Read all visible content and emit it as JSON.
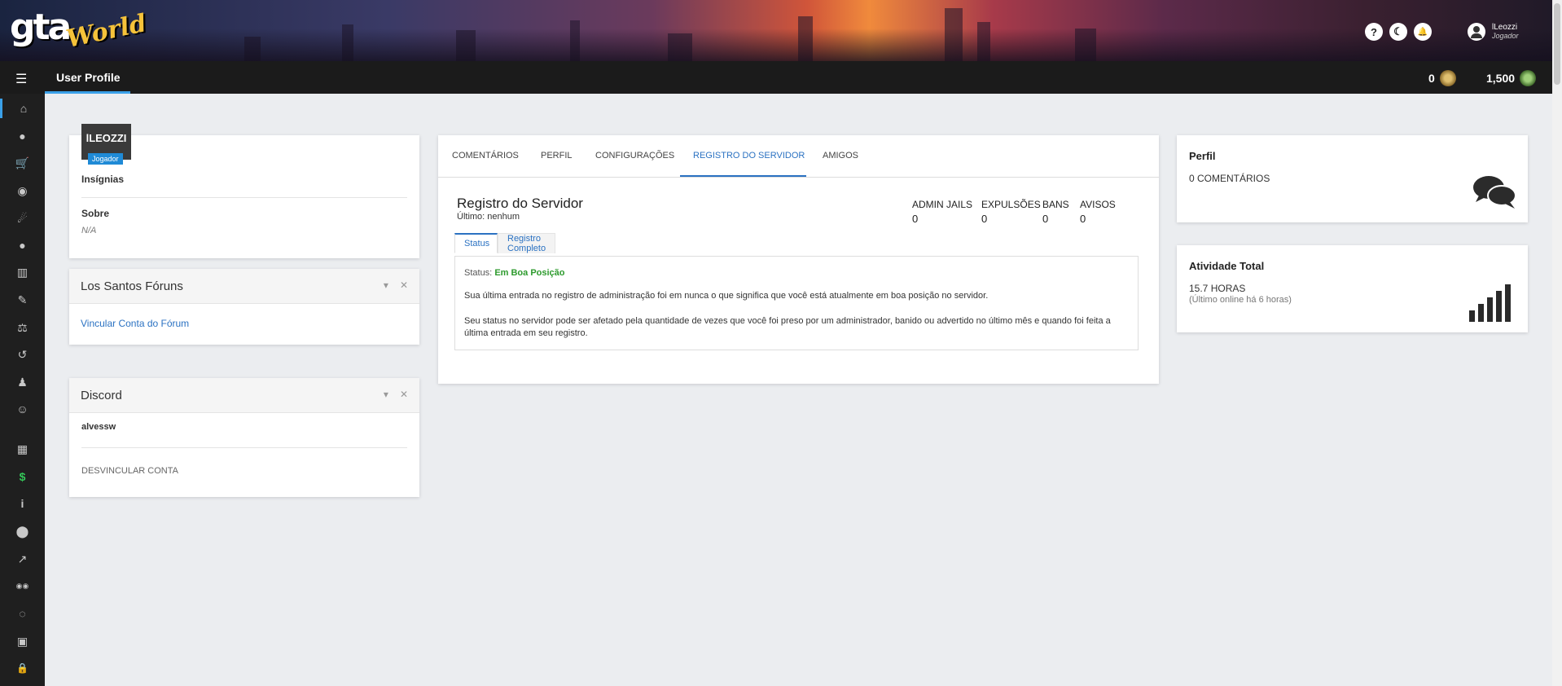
{
  "brand": {
    "main": "gta",
    "accent": "World"
  },
  "header": {
    "buttons": [
      {
        "icon": "help-icon",
        "glyph": "?"
      },
      {
        "icon": "moon-icon",
        "glyph": "☾"
      },
      {
        "icon": "bell-icon",
        "glyph": "🔔"
      }
    ],
    "user": {
      "name": "lLeozzi",
      "role": "Jogador"
    }
  },
  "topnav": {
    "page_title": "User Profile",
    "currency_1": "0",
    "currency_2": "1,500"
  },
  "sidebar": {
    "icons": [
      "home-icon",
      "user-icon",
      "cart-icon",
      "mask-icon",
      "broadcast-icon",
      "chat-icon",
      "building-icon",
      "brush-icon",
      "scale-icon",
      "history-icon",
      "user-tie-icon",
      "face-icon",
      "keyboard-icon",
      "dollar-icon",
      "info-icon",
      "map-pin-icon",
      "external-link-icon",
      "users-icon",
      "comments-icon",
      "discord-icon",
      "lock-icon"
    ],
    "glyphs": [
      "⌂",
      "●",
      "🛒",
      "◉",
      "☄",
      "●",
      "▥",
      "✎",
      "⚖",
      "↺",
      "♟",
      "☺",
      "▦",
      "$",
      "i",
      "⬤",
      "↗",
      "◉◉",
      "◌",
      "▣",
      "🔒"
    ]
  },
  "profile": {
    "username": "lLEOZZI",
    "badge": "Jogador",
    "badges_label": "Insígnias",
    "about_label": "Sobre",
    "about_value": "N/A"
  },
  "forums": {
    "title": "Los Santos Fóruns",
    "link": "Vincular Conta do Fórum",
    "collapse": "▾",
    "close": "✕"
  },
  "discord": {
    "title": "Discord",
    "username": "alvessw",
    "unlink": "DESVINCULAR CONTA",
    "collapse": "▾",
    "close": "✕"
  },
  "main": {
    "tabs": [
      "COMENTÁRIOS",
      "PERFIL",
      "CONFIGURAÇÕES",
      "REGISTRO DO SERVIDOR",
      "AMIGOS"
    ],
    "active_tab": "REGISTRO DO SERVIDOR",
    "title": "Registro do Servidor",
    "last": "Último: nenhum",
    "stats": [
      {
        "label": "ADMIN JAILS",
        "value": "0"
      },
      {
        "label": "EXPULSÕES",
        "value": "0"
      },
      {
        "label": "BANS",
        "value": "0"
      },
      {
        "label": "AVISOS",
        "value": "0"
      }
    ],
    "subtabs": [
      "Status",
      "Registro Completo"
    ],
    "status_label": "Status:",
    "status_value": "Em Boa Posição",
    "para1": "Sua última entrada no registro de administração foi em nunca o que significa que você está atualmente em boa posição no servidor.",
    "para2": "Seu status no servidor pode ser afetado pela quantidade de vezes que você foi preso por um administrador, banido ou advertido no último mês e quando foi feita a última entrada em seu registro."
  },
  "perfil_card": {
    "title": "Perfil",
    "value": "0 COMENTÁRIOS"
  },
  "activity_card": {
    "title": "Atividade Total",
    "value": "15.7 HORAS",
    "sub": "(Último online há 6 horas)"
  }
}
